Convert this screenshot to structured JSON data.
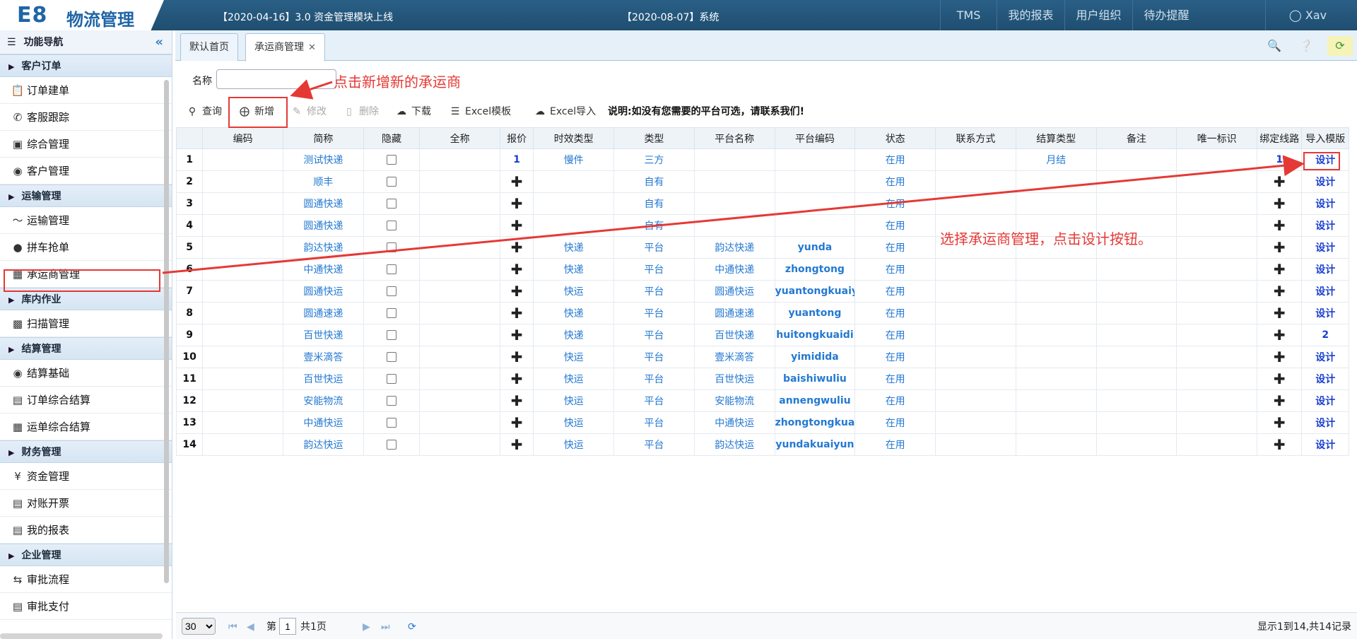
{
  "topbar": {
    "logo_e8": "E8",
    "logo_text": "物流管理",
    "notice1": "【2020-04-16】3.0 资金管理模块上线",
    "notice2": "【2020-08-07】系统",
    "nav": [
      "TMS",
      "我的报表",
      "用户组织",
      "待办提醒"
    ],
    "user": "Xav"
  },
  "sidebar": {
    "header": "功能导航",
    "groups": [
      {
        "label": "客户订单",
        "items": [
          {
            "label": "订单建单",
            "icon": "clipboard-icon"
          },
          {
            "label": "客服跟踪",
            "icon": "phone-icon"
          },
          {
            "label": "综合管理",
            "icon": "monitor-icon"
          },
          {
            "label": "客户管理",
            "icon": "users-icon"
          }
        ]
      },
      {
        "label": "运输管理",
        "items": [
          {
            "label": "运输管理",
            "icon": "route-icon"
          },
          {
            "label": "拼车抢单",
            "icon": "map-pin-icon"
          },
          {
            "label": "承运商管理",
            "icon": "bus-icon"
          }
        ]
      },
      {
        "label": "库内作业",
        "items": [
          {
            "label": "扫描管理",
            "icon": "box-icon"
          }
        ]
      },
      {
        "label": "结算管理",
        "items": [
          {
            "label": "结算基础",
            "icon": "eye-icon"
          },
          {
            "label": "订单综合结算",
            "icon": "document-icon"
          },
          {
            "label": "运单综合结算",
            "icon": "bus-icon"
          }
        ]
      },
      {
        "label": "财务管理",
        "items": [
          {
            "label": "资金管理",
            "icon": "yen-icon"
          },
          {
            "label": "对账开票",
            "icon": "document-icon"
          },
          {
            "label": "我的报表",
            "icon": "document-icon"
          }
        ]
      },
      {
        "label": "企业管理",
        "items": [
          {
            "label": "审批流程",
            "icon": "shuffle-icon"
          },
          {
            "label": "审批支付",
            "icon": "document-icon"
          }
        ]
      }
    ]
  },
  "tabs": [
    "默认首页",
    "承运商管理"
  ],
  "filter": {
    "name_label": "名称",
    "name_value": ""
  },
  "toolbar": {
    "query": "查询",
    "add": "新增",
    "edit": "修改",
    "delete": "删除",
    "download": "下载",
    "excel_template": "Excel模板",
    "excel_import": "Excel导入",
    "note": "说明:如没有您需要的平台可选，请联系我们!"
  },
  "grid": {
    "headers": [
      "",
      "编码",
      "简称",
      "隐藏",
      "全称",
      "报价",
      "时效类型",
      "类型",
      "平台名称",
      "平台编码",
      "状态",
      "联系方式",
      "结算类型",
      "备注",
      "唯一标识",
      "绑定线路",
      "导入模版"
    ],
    "rows": [
      {
        "n": "1",
        "code": "",
        "short": "测试快递",
        "full": "",
        "quote": "1",
        "timing": "慢件",
        "type": "三方",
        "platform": "",
        "pcode": "",
        "status": "在用",
        "contact": "",
        "settle": "月结",
        "remark": "",
        "uid": "",
        "route": "1",
        "tpl": "设计"
      },
      {
        "n": "2",
        "code": "",
        "short": "顺丰",
        "full": "",
        "quote": "+",
        "timing": "",
        "type": "自有",
        "platform": "",
        "pcode": "",
        "status": "在用",
        "contact": "",
        "settle": "",
        "remark": "",
        "uid": "",
        "route": "+",
        "tpl": "设计"
      },
      {
        "n": "3",
        "code": "",
        "short": "圆通快递",
        "full": "",
        "quote": "+",
        "timing": "",
        "type": "自有",
        "platform": "",
        "pcode": "",
        "status": "在用",
        "contact": "",
        "settle": "",
        "remark": "",
        "uid": "",
        "route": "+",
        "tpl": "设计"
      },
      {
        "n": "4",
        "code": "",
        "short": "圆通快递",
        "full": "",
        "quote": "+",
        "timing": "",
        "type": "自有",
        "platform": "",
        "pcode": "",
        "status": "在用",
        "contact": "",
        "settle": "",
        "remark": "",
        "uid": "",
        "route": "+",
        "tpl": "设计"
      },
      {
        "n": "5",
        "code": "",
        "short": "韵达快递",
        "full": "",
        "quote": "+",
        "timing": "快递",
        "type": "平台",
        "platform": "韵达快递",
        "pcode": "yunda",
        "status": "在用",
        "contact": "",
        "settle": "",
        "remark": "",
        "uid": "",
        "route": "+",
        "tpl": "设计"
      },
      {
        "n": "6",
        "code": "",
        "short": "中通快递",
        "full": "",
        "quote": "+",
        "timing": "快递",
        "type": "平台",
        "platform": "中通快递",
        "pcode": "zhongtong",
        "status": "在用",
        "contact": "",
        "settle": "",
        "remark": "",
        "uid": "",
        "route": "+",
        "tpl": "设计"
      },
      {
        "n": "7",
        "code": "",
        "short": "圆通快运",
        "full": "",
        "quote": "+",
        "timing": "快运",
        "type": "平台",
        "platform": "圆通快运",
        "pcode": "yuantongkuaiy",
        "status": "在用",
        "contact": "",
        "settle": "",
        "remark": "",
        "uid": "",
        "route": "+",
        "tpl": "设计"
      },
      {
        "n": "8",
        "code": "",
        "short": "圆通速递",
        "full": "",
        "quote": "+",
        "timing": "快递",
        "type": "平台",
        "platform": "圆通速递",
        "pcode": "yuantong",
        "status": "在用",
        "contact": "",
        "settle": "",
        "remark": "",
        "uid": "",
        "route": "+",
        "tpl": "设计"
      },
      {
        "n": "9",
        "code": "",
        "short": "百世快递",
        "full": "",
        "quote": "+",
        "timing": "快递",
        "type": "平台",
        "platform": "百世快递",
        "pcode": "huitongkuaidi",
        "status": "在用",
        "contact": "",
        "settle": "",
        "remark": "",
        "uid": "",
        "route": "+",
        "tpl": "2"
      },
      {
        "n": "10",
        "code": "",
        "short": "壹米滴答",
        "full": "",
        "quote": "+",
        "timing": "快运",
        "type": "平台",
        "platform": "壹米滴答",
        "pcode": "yimidida",
        "status": "在用",
        "contact": "",
        "settle": "",
        "remark": "",
        "uid": "",
        "route": "+",
        "tpl": "设计"
      },
      {
        "n": "11",
        "code": "",
        "short": "百世快运",
        "full": "",
        "quote": "+",
        "timing": "快运",
        "type": "平台",
        "platform": "百世快运",
        "pcode": "baishiwuliu",
        "status": "在用",
        "contact": "",
        "settle": "",
        "remark": "",
        "uid": "",
        "route": "+",
        "tpl": "设计"
      },
      {
        "n": "12",
        "code": "",
        "short": "安能物流",
        "full": "",
        "quote": "+",
        "timing": "快运",
        "type": "平台",
        "platform": "安能物流",
        "pcode": "annengwuliu",
        "status": "在用",
        "contact": "",
        "settle": "",
        "remark": "",
        "uid": "",
        "route": "+",
        "tpl": "设计"
      },
      {
        "n": "13",
        "code": "",
        "short": "中通快运",
        "full": "",
        "quote": "+",
        "timing": "快运",
        "type": "平台",
        "platform": "中通快运",
        "pcode": "zhongtongkua",
        "status": "在用",
        "contact": "",
        "settle": "",
        "remark": "",
        "uid": "",
        "route": "+",
        "tpl": "设计"
      },
      {
        "n": "14",
        "code": "",
        "short": "韵达快运",
        "full": "",
        "quote": "+",
        "timing": "快运",
        "type": "平台",
        "platform": "韵达快运",
        "pcode": "yundakuaiyun",
        "status": "在用",
        "contact": "",
        "settle": "",
        "remark": "",
        "uid": "",
        "route": "+",
        "tpl": "设计"
      }
    ]
  },
  "pager": {
    "page_size": "30",
    "page_prefix": "第",
    "page_value": "1",
    "page_total": "共1页",
    "summary": "显示1到14,共14记录"
  },
  "annotations": {
    "add_hint": "点击新增新的承运商",
    "design_hint": "选择承运商管理，点击设计按钮。"
  },
  "colors": {
    "accent": "#2479d2",
    "topbar": "#2a5f86",
    "annotation": "#e53935"
  }
}
